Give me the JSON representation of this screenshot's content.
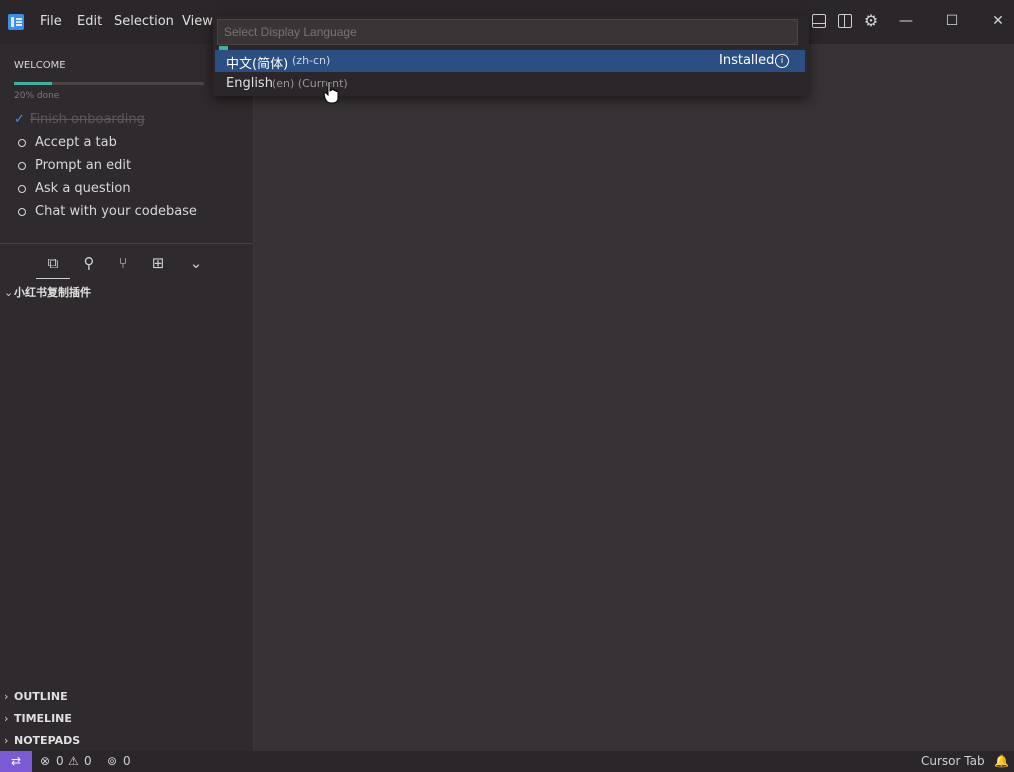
{
  "menu": [
    "File",
    "Edit",
    "Selection",
    "View"
  ],
  "quick_pick": {
    "placeholder": "Select Display Language",
    "items": [
      {
        "label": "中文(简体)",
        "description": "(zh-cn)",
        "detail": "Installed"
      },
      {
        "label": "English",
        "description": "(en) (Current)"
      }
    ]
  },
  "sidebar": {
    "welcome_title": "WELCOME",
    "progress_percent": 20,
    "progress_text": "20% done",
    "steps": [
      "Finish onboarding",
      "Accept a tab",
      "Prompt an edit",
      "Ask a question",
      "Chat with your codebase"
    ],
    "folder_title": "小红书复制插件",
    "sections": [
      "OUTLINE",
      "TIMELINE",
      "NOTEPADS"
    ]
  },
  "status": {
    "errors": "0",
    "warnings": "0",
    "ports": "0",
    "right_label": "Cursor Tab"
  },
  "colors": {
    "background": "#373235",
    "sidebar": "#2f2a2d",
    "selection": "#2c4f83",
    "accent": "#3fb0a0",
    "remote": "#7c5ad6"
  }
}
